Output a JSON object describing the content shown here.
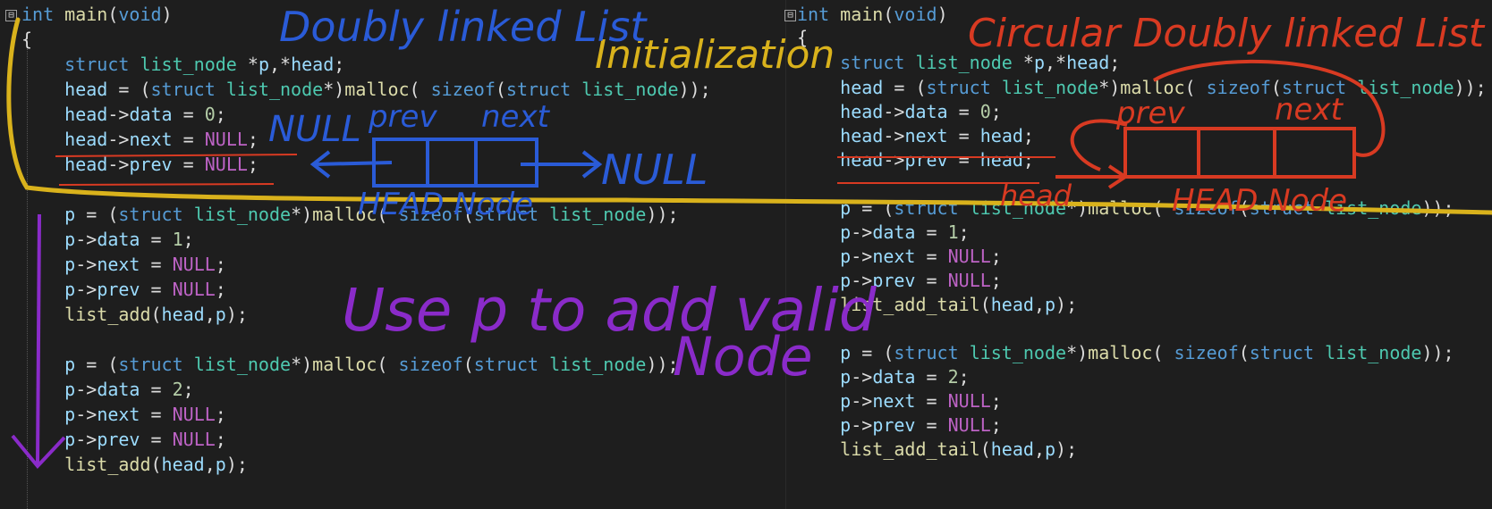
{
  "left": {
    "lines": [
      [
        [
          "kw",
          "int"
        ],
        [
          "plain",
          " "
        ],
        [
          "fn",
          "main"
        ],
        [
          "plain",
          "("
        ],
        [
          "kw",
          "void"
        ],
        [
          "plain",
          ")"
        ]
      ],
      [
        [
          "plain",
          "{"
        ]
      ],
      [
        [
          "plain",
          "    "
        ],
        [
          "kw",
          "struct"
        ],
        [
          "plain",
          " "
        ],
        [
          "type",
          "list_node"
        ],
        [
          "plain",
          " *"
        ],
        [
          "var",
          "p"
        ],
        [
          "plain",
          ",*"
        ],
        [
          "var",
          "head"
        ],
        [
          "plain",
          ";"
        ]
      ],
      [
        [
          "plain",
          "    "
        ],
        [
          "var",
          "head"
        ],
        [
          "plain",
          " = ("
        ],
        [
          "kw",
          "struct"
        ],
        [
          "plain",
          " "
        ],
        [
          "type",
          "list_node"
        ],
        [
          "plain",
          "*)"
        ],
        [
          "fn",
          "malloc"
        ],
        [
          "plain",
          "( "
        ],
        [
          "kw",
          "sizeof"
        ],
        [
          "plain",
          "("
        ],
        [
          "kw",
          "struct"
        ],
        [
          "plain",
          " "
        ],
        [
          "type",
          "list_node"
        ],
        [
          "plain",
          "));"
        ]
      ],
      [
        [
          "plain",
          "    "
        ],
        [
          "var",
          "head"
        ],
        [
          "plain",
          "->"
        ],
        [
          "var",
          "data"
        ],
        [
          "plain",
          " = "
        ],
        [
          "num",
          "0"
        ],
        [
          "plain",
          ";"
        ]
      ],
      [
        [
          "plain",
          "    "
        ],
        [
          "var",
          "head"
        ],
        [
          "plain",
          "->"
        ],
        [
          "var",
          "next"
        ],
        [
          "plain",
          " = "
        ],
        [
          "mac",
          "NULL"
        ],
        [
          "plain",
          ";"
        ]
      ],
      [
        [
          "plain",
          "    "
        ],
        [
          "var",
          "head"
        ],
        [
          "plain",
          "->"
        ],
        [
          "var",
          "prev"
        ],
        [
          "plain",
          " = "
        ],
        [
          "mac",
          "NULL"
        ],
        [
          "plain",
          ";"
        ]
      ],
      [],
      [
        [
          "plain",
          "    "
        ],
        [
          "var",
          "p"
        ],
        [
          "plain",
          " = ("
        ],
        [
          "kw",
          "struct"
        ],
        [
          "plain",
          " "
        ],
        [
          "type",
          "list_node"
        ],
        [
          "plain",
          "*)"
        ],
        [
          "fn",
          "malloc"
        ],
        [
          "plain",
          "( "
        ],
        [
          "kw",
          "sizeof"
        ],
        [
          "plain",
          "("
        ],
        [
          "kw",
          "struct"
        ],
        [
          "plain",
          " "
        ],
        [
          "type",
          "list_node"
        ],
        [
          "plain",
          "));"
        ]
      ],
      [
        [
          "plain",
          "    "
        ],
        [
          "var",
          "p"
        ],
        [
          "plain",
          "->"
        ],
        [
          "var",
          "data"
        ],
        [
          "plain",
          " = "
        ],
        [
          "num",
          "1"
        ],
        [
          "plain",
          ";"
        ]
      ],
      [
        [
          "plain",
          "    "
        ],
        [
          "var",
          "p"
        ],
        [
          "plain",
          "->"
        ],
        [
          "var",
          "next"
        ],
        [
          "plain",
          " = "
        ],
        [
          "mac",
          "NULL"
        ],
        [
          "plain",
          ";"
        ]
      ],
      [
        [
          "plain",
          "    "
        ],
        [
          "var",
          "p"
        ],
        [
          "plain",
          "->"
        ],
        [
          "var",
          "prev"
        ],
        [
          "plain",
          " = "
        ],
        [
          "mac",
          "NULL"
        ],
        [
          "plain",
          ";"
        ]
      ],
      [
        [
          "plain",
          "    "
        ],
        [
          "fn",
          "list_add"
        ],
        [
          "plain",
          "("
        ],
        [
          "var",
          "head"
        ],
        [
          "plain",
          ","
        ],
        [
          "var",
          "p"
        ],
        [
          "plain",
          ");"
        ]
      ],
      [],
      [
        [
          "plain",
          "    "
        ],
        [
          "var",
          "p"
        ],
        [
          "plain",
          " = ("
        ],
        [
          "kw",
          "struct"
        ],
        [
          "plain",
          " "
        ],
        [
          "type",
          "list_node"
        ],
        [
          "plain",
          "*)"
        ],
        [
          "fn",
          "malloc"
        ],
        [
          "plain",
          "( "
        ],
        [
          "kw",
          "sizeof"
        ],
        [
          "plain",
          "("
        ],
        [
          "kw",
          "struct"
        ],
        [
          "plain",
          " "
        ],
        [
          "type",
          "list_node"
        ],
        [
          "plain",
          "));"
        ]
      ],
      [
        [
          "plain",
          "    "
        ],
        [
          "var",
          "p"
        ],
        [
          "plain",
          "->"
        ],
        [
          "var",
          "data"
        ],
        [
          "plain",
          " = "
        ],
        [
          "num",
          "2"
        ],
        [
          "plain",
          ";"
        ]
      ],
      [
        [
          "plain",
          "    "
        ],
        [
          "var",
          "p"
        ],
        [
          "plain",
          "->"
        ],
        [
          "var",
          "next"
        ],
        [
          "plain",
          " = "
        ],
        [
          "mac",
          "NULL"
        ],
        [
          "plain",
          ";"
        ]
      ],
      [
        [
          "plain",
          "    "
        ],
        [
          "var",
          "p"
        ],
        [
          "plain",
          "->"
        ],
        [
          "var",
          "prev"
        ],
        [
          "plain",
          " = "
        ],
        [
          "mac",
          "NULL"
        ],
        [
          "plain",
          ";"
        ]
      ],
      [
        [
          "plain",
          "    "
        ],
        [
          "fn",
          "list_add"
        ],
        [
          "plain",
          "("
        ],
        [
          "var",
          "head"
        ],
        [
          "plain",
          ","
        ],
        [
          "var",
          "p"
        ],
        [
          "plain",
          ");"
        ]
      ]
    ]
  },
  "right": {
    "lines": [
      [
        [
          "kw",
          "int"
        ],
        [
          "plain",
          " "
        ],
        [
          "fn",
          "main"
        ],
        [
          "plain",
          "("
        ],
        [
          "kw",
          "void"
        ],
        [
          "plain",
          ")"
        ]
      ],
      [
        [
          "plain",
          "{"
        ]
      ],
      [
        [
          "plain",
          "    "
        ],
        [
          "kw",
          "struct"
        ],
        [
          "plain",
          " "
        ],
        [
          "type",
          "list_node"
        ],
        [
          "plain",
          " *"
        ],
        [
          "var",
          "p"
        ],
        [
          "plain",
          ",*"
        ],
        [
          "var",
          "head"
        ],
        [
          "plain",
          ";"
        ]
      ],
      [
        [
          "plain",
          "    "
        ],
        [
          "var",
          "head"
        ],
        [
          "plain",
          " = ("
        ],
        [
          "kw",
          "struct"
        ],
        [
          "plain",
          " "
        ],
        [
          "type",
          "list_node"
        ],
        [
          "plain",
          "*)"
        ],
        [
          "fn",
          "malloc"
        ],
        [
          "plain",
          "( "
        ],
        [
          "kw",
          "sizeof"
        ],
        [
          "plain",
          "("
        ],
        [
          "kw",
          "struct"
        ],
        [
          "plain",
          " "
        ],
        [
          "type",
          "list_node"
        ],
        [
          "plain",
          "));"
        ]
      ],
      [
        [
          "plain",
          "    "
        ],
        [
          "var",
          "head"
        ],
        [
          "plain",
          "->"
        ],
        [
          "var",
          "data"
        ],
        [
          "plain",
          " = "
        ],
        [
          "num",
          "0"
        ],
        [
          "plain",
          ";"
        ]
      ],
      [
        [
          "plain",
          "    "
        ],
        [
          "var",
          "head"
        ],
        [
          "plain",
          "->"
        ],
        [
          "var",
          "next"
        ],
        [
          "plain",
          " = "
        ],
        [
          "var",
          "head"
        ],
        [
          "plain",
          ";"
        ]
      ],
      [
        [
          "plain",
          "    "
        ],
        [
          "var",
          "head"
        ],
        [
          "plain",
          "->"
        ],
        [
          "var",
          "prev"
        ],
        [
          "plain",
          " = "
        ],
        [
          "var",
          "head"
        ],
        [
          "plain",
          ";"
        ]
      ],
      [],
      [
        [
          "plain",
          "    "
        ],
        [
          "var",
          "p"
        ],
        [
          "plain",
          " = ("
        ],
        [
          "kw",
          "struct"
        ],
        [
          "plain",
          " "
        ],
        [
          "type",
          "list_node"
        ],
        [
          "plain",
          "*)"
        ],
        [
          "fn",
          "malloc"
        ],
        [
          "plain",
          "( "
        ],
        [
          "kw",
          "sizeof"
        ],
        [
          "plain",
          "("
        ],
        [
          "kw",
          "struct"
        ],
        [
          "plain",
          " "
        ],
        [
          "type",
          "list_node"
        ],
        [
          "plain",
          "));"
        ]
      ],
      [
        [
          "plain",
          "    "
        ],
        [
          "var",
          "p"
        ],
        [
          "plain",
          "->"
        ],
        [
          "var",
          "data"
        ],
        [
          "plain",
          " = "
        ],
        [
          "num",
          "1"
        ],
        [
          "plain",
          ";"
        ]
      ],
      [
        [
          "plain",
          "    "
        ],
        [
          "var",
          "p"
        ],
        [
          "plain",
          "->"
        ],
        [
          "var",
          "next"
        ],
        [
          "plain",
          " = "
        ],
        [
          "mac",
          "NULL"
        ],
        [
          "plain",
          ";"
        ]
      ],
      [
        [
          "plain",
          "    "
        ],
        [
          "var",
          "p"
        ],
        [
          "plain",
          "->"
        ],
        [
          "var",
          "prev"
        ],
        [
          "plain",
          " = "
        ],
        [
          "mac",
          "NULL"
        ],
        [
          "plain",
          ";"
        ]
      ],
      [
        [
          "plain",
          "    "
        ],
        [
          "fn",
          "list_add_tail"
        ],
        [
          "plain",
          "("
        ],
        [
          "var",
          "head"
        ],
        [
          "plain",
          ","
        ],
        [
          "var",
          "p"
        ],
        [
          "plain",
          ");"
        ]
      ],
      [],
      [
        [
          "plain",
          "    "
        ],
        [
          "var",
          "p"
        ],
        [
          "plain",
          " = ("
        ],
        [
          "kw",
          "struct"
        ],
        [
          "plain",
          " "
        ],
        [
          "type",
          "list_node"
        ],
        [
          "plain",
          "*)"
        ],
        [
          "fn",
          "malloc"
        ],
        [
          "plain",
          "( "
        ],
        [
          "kw",
          "sizeof"
        ],
        [
          "plain",
          "("
        ],
        [
          "kw",
          "struct"
        ],
        [
          "plain",
          " "
        ],
        [
          "type",
          "list_node"
        ],
        [
          "plain",
          "));"
        ]
      ],
      [
        [
          "plain",
          "    "
        ],
        [
          "var",
          "p"
        ],
        [
          "plain",
          "->"
        ],
        [
          "var",
          "data"
        ],
        [
          "plain",
          " = "
        ],
        [
          "num",
          "2"
        ],
        [
          "plain",
          ";"
        ]
      ],
      [
        [
          "plain",
          "    "
        ],
        [
          "var",
          "p"
        ],
        [
          "plain",
          "->"
        ],
        [
          "var",
          "next"
        ],
        [
          "plain",
          " = "
        ],
        [
          "mac",
          "NULL"
        ],
        [
          "plain",
          ";"
        ]
      ],
      [
        [
          "plain",
          "    "
        ],
        [
          "var",
          "p"
        ],
        [
          "plain",
          "->"
        ],
        [
          "var",
          "prev"
        ],
        [
          "plain",
          " = "
        ],
        [
          "mac",
          "NULL"
        ],
        [
          "plain",
          ";"
        ]
      ],
      [
        [
          "plain",
          "    "
        ],
        [
          "fn",
          "list_add_tail"
        ],
        [
          "plain",
          "("
        ],
        [
          "var",
          "head"
        ],
        [
          "plain",
          ","
        ],
        [
          "var",
          "p"
        ],
        [
          "plain",
          ");"
        ]
      ]
    ]
  },
  "fold_marker": "⊟",
  "annotations": {
    "doubly_title": "Doubly linked List",
    "initialization": "Initialization",
    "circular_title": "Circular Doubly linked List",
    "prev": "prev",
    "next": "next",
    "null": "NULL",
    "head_node": "HEAD Node",
    "head": "head",
    "use_p_line1": "Use p to add valid",
    "use_p_line2": "Node"
  },
  "colors": {
    "background": "#1e1e1e",
    "keyword": "#569cd6",
    "type": "#4ec9b0",
    "function": "#dcdcaa",
    "variable": "#9cdcfe",
    "macro": "#bd63c5",
    "number": "#b5cea8",
    "ink_blue": "#2a5bd7",
    "ink_yellow": "#d9b21c",
    "ink_red": "#d83a22",
    "ink_purple": "#8a2bc9"
  }
}
